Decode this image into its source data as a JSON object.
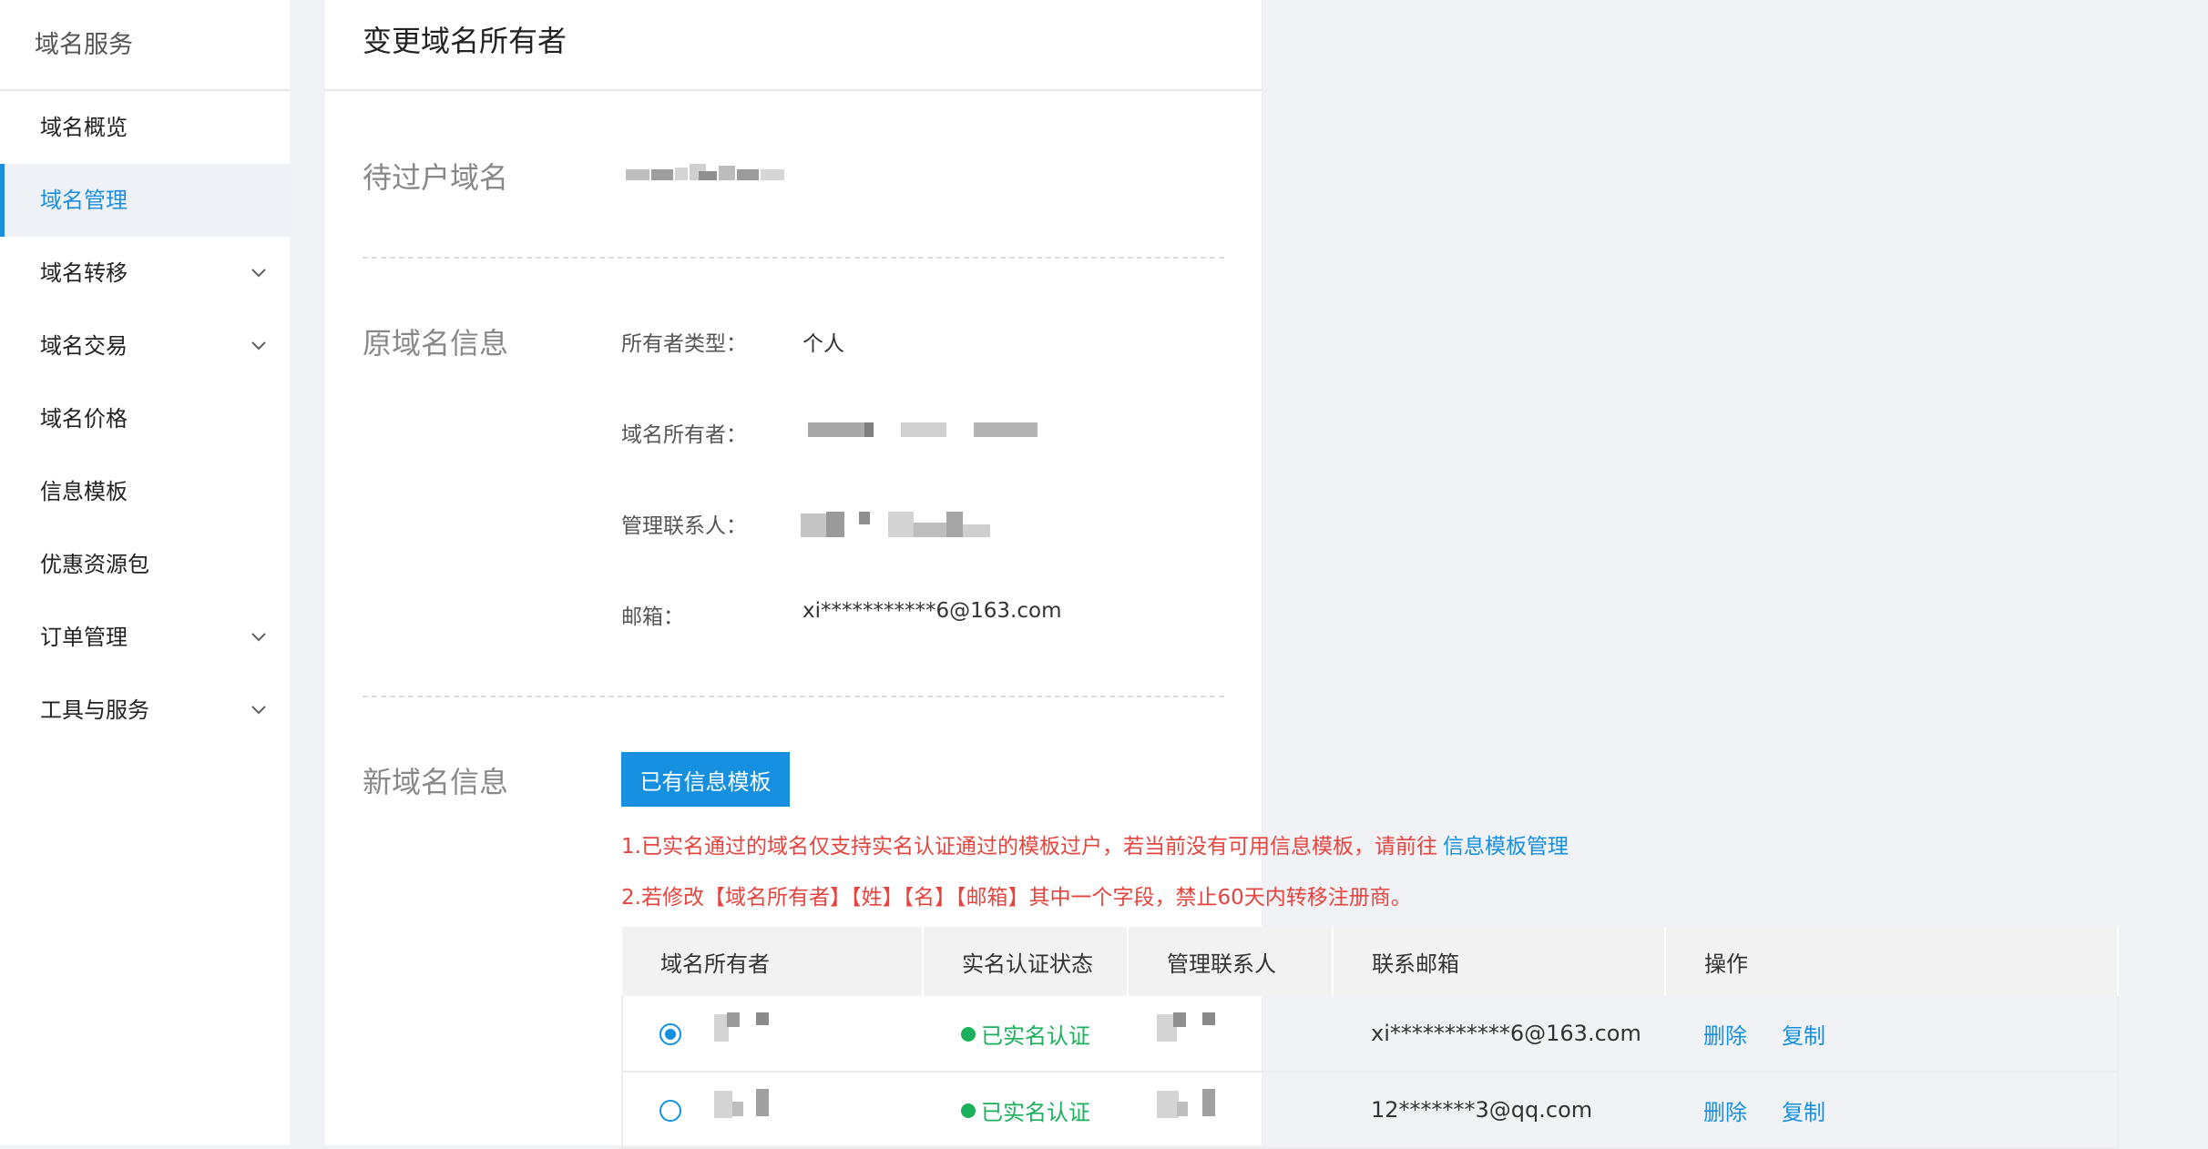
{
  "sidebar": {
    "title": "域名服务",
    "items": [
      {
        "label": "域名概览",
        "expandable": false,
        "active": false
      },
      {
        "label": "域名管理",
        "expandable": false,
        "active": true
      },
      {
        "label": "域名转移",
        "expandable": true,
        "active": false
      },
      {
        "label": "域名交易",
        "expandable": true,
        "active": false
      },
      {
        "label": "域名价格",
        "expandable": false,
        "active": false
      },
      {
        "label": "信息模板",
        "expandable": false,
        "active": false
      },
      {
        "label": "优惠资源包",
        "expandable": false,
        "active": false
      },
      {
        "label": "订单管理",
        "expandable": true,
        "active": false
      },
      {
        "label": "工具与服务",
        "expandable": true,
        "active": false
      }
    ]
  },
  "page": {
    "title": "变更域名所有者",
    "pending_section": {
      "label": "待过户域名"
    },
    "original_section": {
      "label": "原域名信息",
      "owner_type_label": "所有者类型：",
      "owner_type_value": "个人",
      "owner_label": "域名所有者：",
      "contact_label": "管理联系人：",
      "email_label": "邮箱：",
      "email_value": "xi***********6@163.com"
    },
    "new_section": {
      "label": "新域名信息",
      "template_button": "已有信息模板",
      "notice1_text": "1.已实名通过的域名仅支持实名认证通过的模板过户，若当前没有可用信息模板，请前往",
      "notice1_link": "信息模板管理",
      "notice2_text": "2.若修改【域名所有者】【姓】【名】【邮箱】其中一个字段，禁止60天内转移注册商。",
      "table": {
        "headers": [
          "域名所有者",
          "实名认证状态",
          "管理联系人",
          "联系邮箱",
          "操作"
        ],
        "rows": [
          {
            "selected": true,
            "status": "已实名认证",
            "email": "xi***********6@163.com",
            "delete": "删除",
            "copy": "复制"
          },
          {
            "selected": false,
            "status": "已实名认证",
            "email": "12*******3@qq.com",
            "delete": "删除",
            "copy": "复制"
          }
        ]
      }
    }
  },
  "colors": {
    "accent": "#1590e0",
    "success": "#1cb05c",
    "warning": "#e6453f"
  }
}
